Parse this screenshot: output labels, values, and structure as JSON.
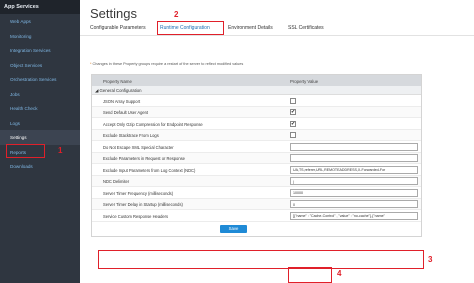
{
  "sidebar": {
    "header": "App Services",
    "items": [
      {
        "label": "Web Apps"
      },
      {
        "label": "Monitoring"
      },
      {
        "label": "Integration Services"
      },
      {
        "label": "Object Services"
      },
      {
        "label": "Orchestration Services"
      },
      {
        "label": "Jobs"
      },
      {
        "label": "Health Check"
      },
      {
        "label": "Logs"
      },
      {
        "label": "Settings"
      },
      {
        "label": "Reports"
      },
      {
        "label": "Downloads"
      }
    ]
  },
  "page": {
    "title": "Settings",
    "tabs": [
      {
        "label": "Configurable Parameters"
      },
      {
        "label": "Runtime Configuration"
      },
      {
        "label": "Environment Details"
      },
      {
        "label": "SSL Certificates"
      }
    ],
    "info_star": "*",
    "info_text": "Changes in these Property groups require a restart of the server to reflect modified values"
  },
  "table": {
    "headers": {
      "name": "Property Name",
      "value": "Property Value"
    },
    "group": "General Configuration",
    "rows": [
      {
        "label": "JSON Array Support",
        "type": "checkbox",
        "checked": false
      },
      {
        "label": "Send Default User Agent",
        "type": "checkbox",
        "checked": true
      },
      {
        "label": "Accept Only Gzip Compression for Endpoint Response",
        "type": "checkbox",
        "checked": true
      },
      {
        "label": "Exclude Stacktrace From Logs",
        "type": "checkbox",
        "checked": false
      },
      {
        "label": "Do Not Escape XML Special Character",
        "type": "text",
        "value": ""
      },
      {
        "label": "Exclude Parameters in Request or Response",
        "type": "text",
        "value": ""
      },
      {
        "label": "Exclude Input Parameters from Log Context (NDC)",
        "type": "text",
        "value": "UA,TS,referer,URL,REMOTEADDRESS,X-Forwarded-For"
      },
      {
        "label": "NDC Delimiter",
        "type": "text",
        "value": "|"
      },
      {
        "label": "Server Timer Frequency (milliseconds)",
        "type": "text",
        "value": "10000"
      },
      {
        "label": "Server Timer Delay in Startup (milliseconds)",
        "type": "text",
        "value": "0"
      },
      {
        "label": "Service Custom Response Headers",
        "type": "text",
        "value": "[{\"name\" : \"Cache-Control\" , \"value\" : \"no-cache\"},{\"name\""
      }
    ],
    "save_label": "Save"
  },
  "annotations": {
    "a1": "1",
    "a2": "2",
    "a3": "3",
    "a4": "4"
  },
  "colors": {
    "sidebar_bg": "#2f3640",
    "accent": "#1f8ad6",
    "annotation": "#e0202a"
  }
}
